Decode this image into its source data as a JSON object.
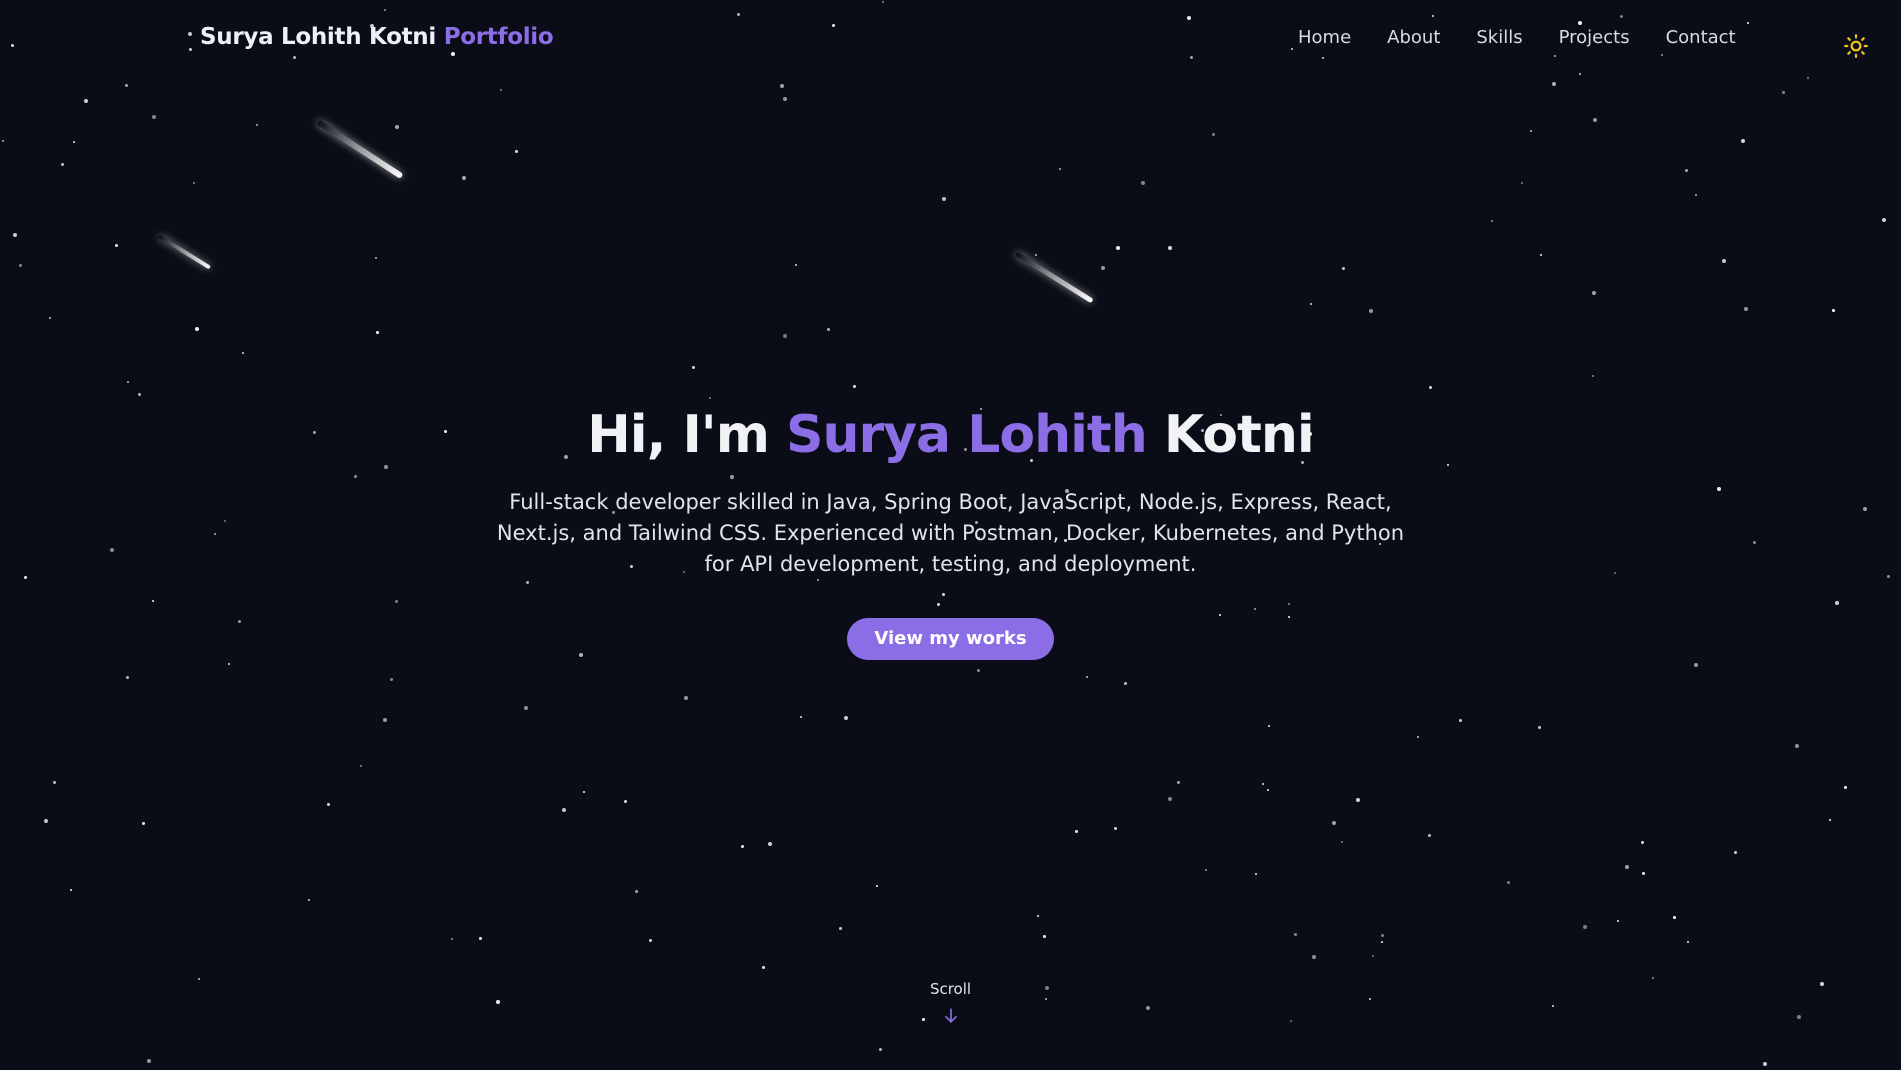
{
  "header": {
    "brand_name": "Surya Lohith Kotni",
    "brand_accent": "Portfolio",
    "nav": [
      {
        "label": "Home"
      },
      {
        "label": "About"
      },
      {
        "label": "Skills"
      },
      {
        "label": "Projects"
      },
      {
        "label": "Contact"
      }
    ],
    "theme_toggle_icon": "sun-icon"
  },
  "hero": {
    "greeting": "Hi, I'm",
    "first_name": "Surya Lohith",
    "last_name": "Kotni",
    "tagline": "Full-stack developer skilled in Java, Spring Boot, JavaScript, Node.js, Express, React, Next.js, and Tailwind CSS. Experienced with Postman, Docker, Kubernetes, and Python for API development, testing, and deployment.",
    "cta_label": "View my works"
  },
  "scroll": {
    "label": "Scroll",
    "icon": "arrow-down-icon"
  },
  "colors": {
    "background": "#0a0d17",
    "accent": "#8b6ee6",
    "text": "#f1f2f6",
    "sun": "#f5c518"
  }
}
